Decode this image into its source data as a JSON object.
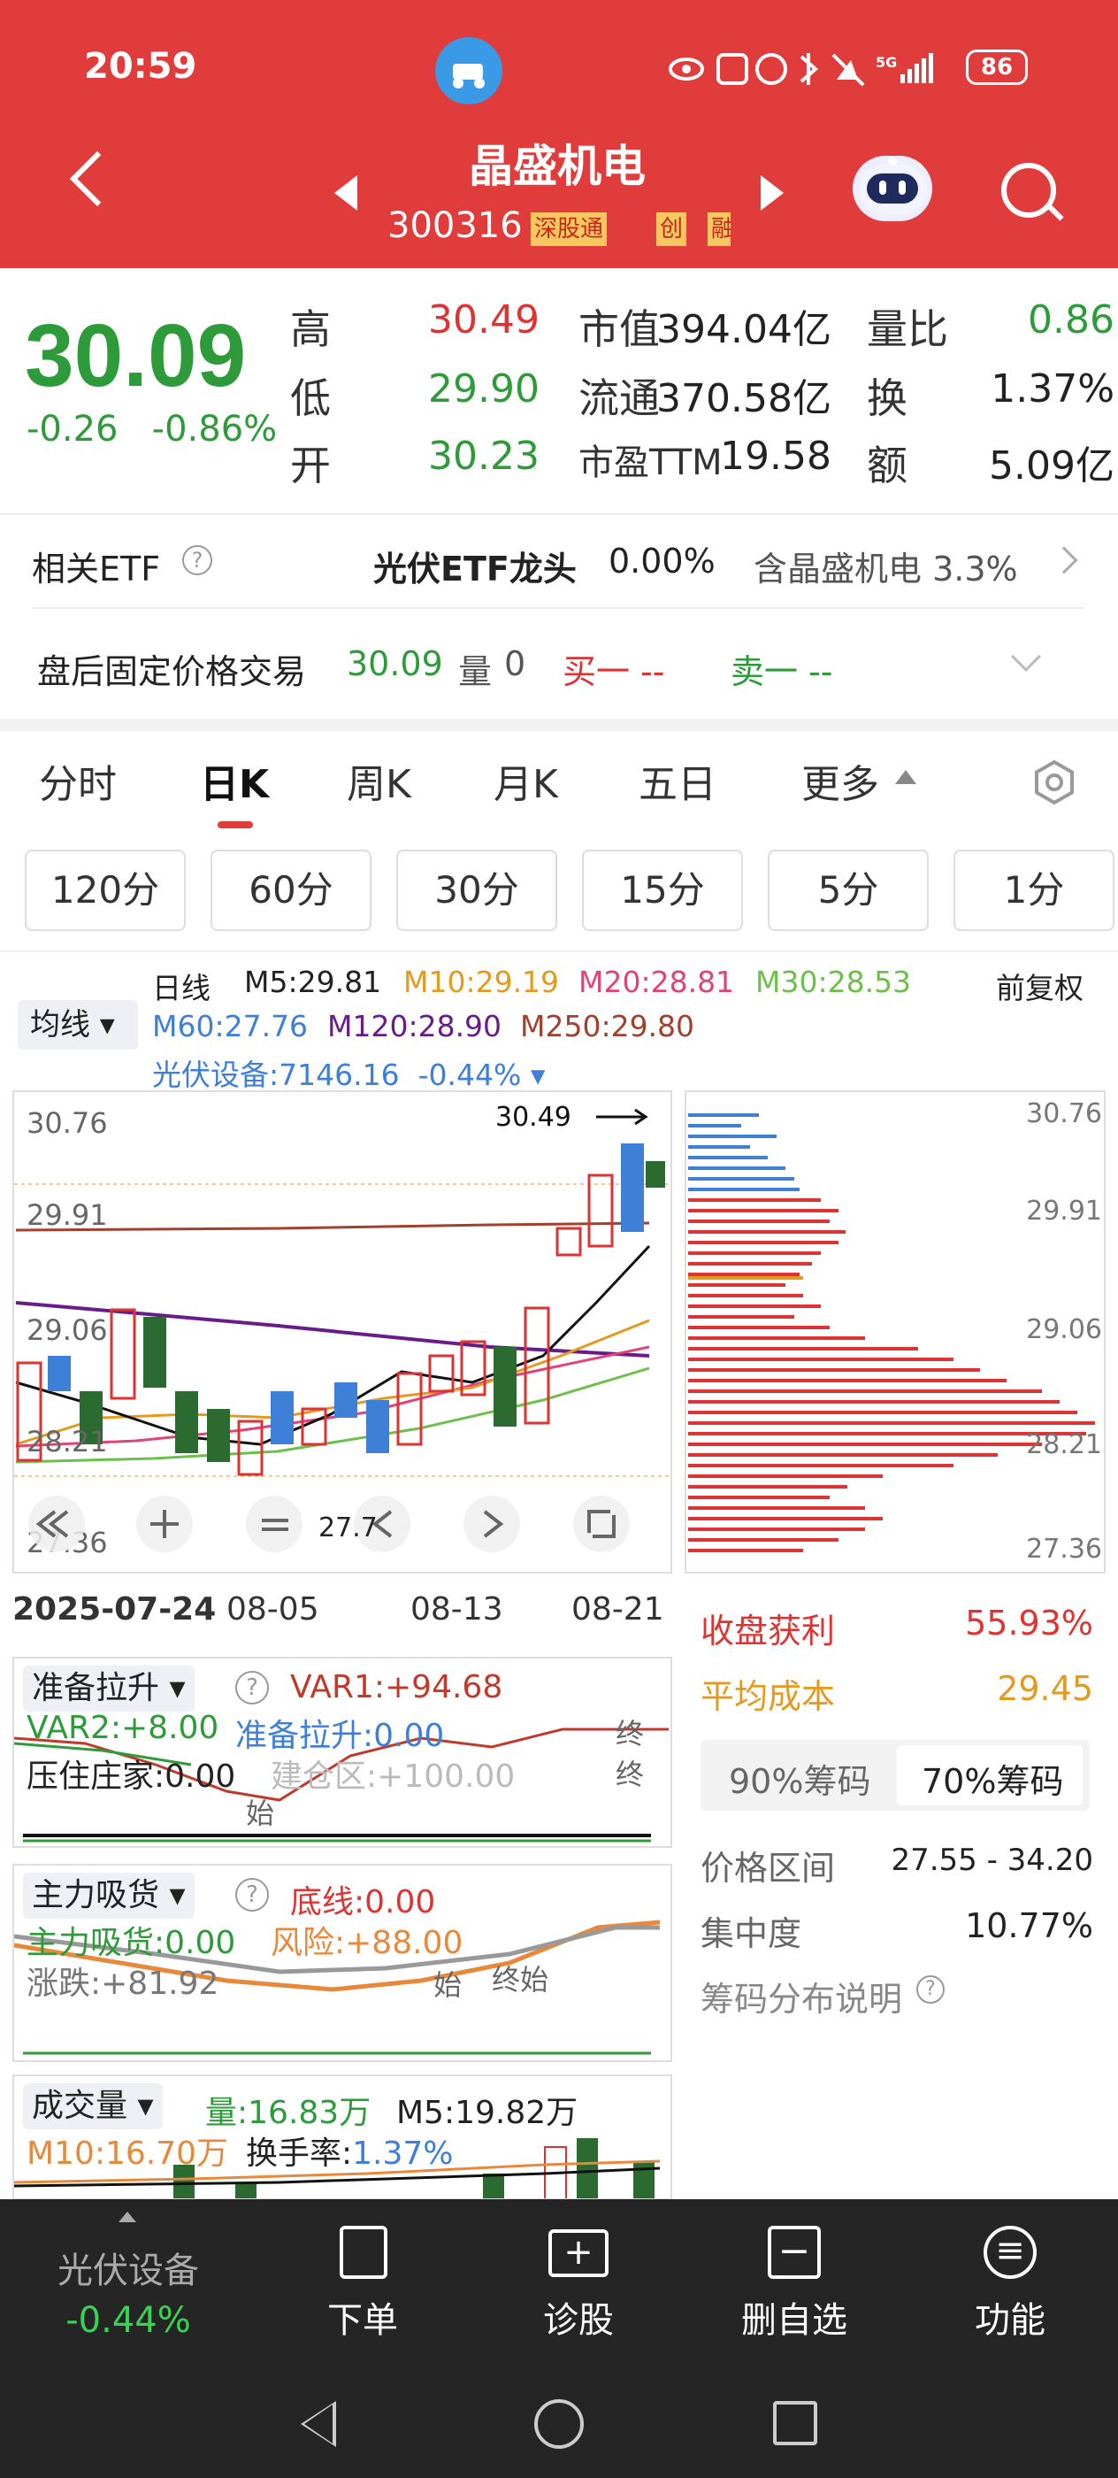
{
  "status_bar": {
    "time": "20:59",
    "battery": "86",
    "signal": "5G"
  },
  "header": {
    "name": "晶盛机电",
    "code": "300316",
    "tags": [
      "深股通",
      "创",
      "融"
    ]
  },
  "quote": {
    "price": "30.09",
    "change": "-0.26",
    "change_pct": "-0.86%",
    "rows": [
      {
        "l1": "高",
        "v1": "30.49",
        "l2": "市值",
        "v2": "394.04亿",
        "l3": "量比",
        "v3": "0.86"
      },
      {
        "l1": "低",
        "v1": "29.90",
        "l2": "流通",
        "v2": "370.58亿",
        "l3": "换",
        "v3": "1.37%"
      },
      {
        "l1": "开",
        "v1": "30.23",
        "l2": "市盈TTM",
        "v2": "19.58",
        "l3": "额",
        "v3": "5.09亿"
      }
    ]
  },
  "etf": {
    "label": "相关ETF",
    "name": "光伏ETF龙头",
    "pct": "0.00%",
    "contains": "含晶盛机电 3.3%"
  },
  "afterhours": {
    "label": "盘后固定价格交易",
    "price": "30.09",
    "vol_label": "量",
    "vol": "0",
    "buy": "买一 --",
    "sell": "卖一 --"
  },
  "tabs": [
    "分时",
    "日K",
    "周K",
    "月K",
    "五日",
    "更多"
  ],
  "periods": [
    "120分",
    "60分",
    "30分",
    "15分",
    "5分",
    "1分"
  ],
  "legend": {
    "mode": "均线",
    "kind": "日线",
    "m5": "M5:29.81",
    "m10": "M10:29.19",
    "m20": "M20:28.81",
    "m30": "M30:28.53",
    "adj": "前复权",
    "m60": "M60:27.76",
    "m120": "M120:28.90",
    "m250": "M250:29.80",
    "sector": "光伏设备:7146.16",
    "sector_pct": "-0.44%"
  },
  "kchart": {
    "ymax": "30.76",
    "y2": "29.91",
    "y3": "29.06",
    "y4": "28.21",
    "ymin": "27.36",
    "high_label": "30.49",
    "zoom_label": "27.7",
    "dates": [
      "2025-07-24",
      "08-05",
      "08-13",
      "08-21"
    ]
  },
  "chips": {
    "ymax": "30.76",
    "y2": "29.91",
    "y3": "29.06",
    "y4": "28.21",
    "ymin": "27.36",
    "profit_label": "收盘获利",
    "profit": "55.93%",
    "cost_label": "平均成本",
    "cost": "29.45",
    "tab90": "90%筹码",
    "tab70": "70%筹码",
    "range_label": "价格区间",
    "range": "27.55 - 34.20",
    "conc_label": "集中度",
    "conc": "10.77%",
    "explain": "筹码分布说明"
  },
  "ind1": {
    "name": "准备拉升",
    "var1": "VAR1:+94.68",
    "var2": "VAR2:+8.00",
    "zbls": "准备拉升:0.00",
    "yzzj": "压住庄家:0.00",
    "jcq": "建仓区:+100.00",
    "start": "始",
    "end": "终终"
  },
  "ind2": {
    "name": "主力吸货",
    "bottom": "底线:0.00",
    "zlxh": "主力吸货:0.00",
    "risk": "风险:+88.00",
    "zd": "涨跌:+81.92",
    "start": "始",
    "mid": "终始"
  },
  "ind3": {
    "name": "成交量",
    "vol": "量:16.83万",
    "m5": "M5:19.82万",
    "m10": "M10:16.70万",
    "turnover_label": "换手率:",
    "turnover": "1.37%"
  },
  "bottom_nav": {
    "sector": "光伏设备",
    "sector_pct": "-0.44%",
    "items": [
      "下单",
      "诊股",
      "删自选",
      "功能"
    ]
  }
}
